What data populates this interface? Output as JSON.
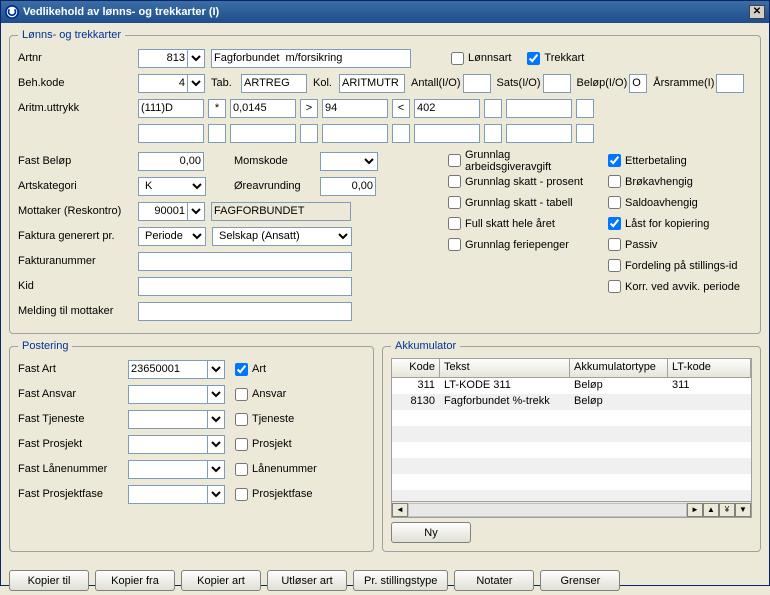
{
  "window": {
    "title": "Vedlikehold av lønns- og trekkarter (I)"
  },
  "group1": {
    "legend": "Lønns- og trekkarter",
    "artnr": {
      "label": "Artnr",
      "value": "813",
      "desc": "Fagforbundet  m/forsikring"
    },
    "lonnsart": "Lønnsart",
    "trekkart": "Trekkart",
    "behkode": {
      "label": "Beh.kode",
      "value": "4"
    },
    "tab": {
      "label": "Tab.",
      "value": "ARTREG"
    },
    "kol": {
      "label": "Kol.",
      "value": "ARITMUTR"
    },
    "antall": {
      "label": "Antall(I/O)"
    },
    "sats": {
      "label": "Sats(I/O)"
    },
    "belop": {
      "label": "Beløp(I/O)",
      "value": "O"
    },
    "arsramme": {
      "label": "Årsramme(I)"
    },
    "aritm": {
      "label": "Aritm.uttrykk",
      "p1": "(111)D",
      "op1": "*",
      "p2": "0,0145",
      "op2": ">",
      "p3": "94",
      "op3": "<",
      "p4": "402"
    },
    "fastbelop": {
      "label": "Fast Beløp",
      "value": "0,00"
    },
    "momskode": {
      "label": "Momskode"
    },
    "artskategori": {
      "label": "Artskategori",
      "value": "K"
    },
    "oreavrunding": {
      "label": "Øreavrunding",
      "value": "0,00"
    },
    "mottaker": {
      "label": "Mottaker (Reskontro)",
      "value": "90001",
      "desc": "FAGFORBUNDET"
    },
    "fakturagen": {
      "label": "Faktura generert pr.",
      "value": "Periode",
      "value2": "Selskap (Ansatt)"
    },
    "fakturanr": {
      "label": "Fakturanummer"
    },
    "kid": {
      "label": "Kid"
    },
    "melding": {
      "label": "Melding til mottaker"
    }
  },
  "checks": {
    "left": [
      "Grunnlag arbeidsgiveravgift",
      "Grunnlag skatt - prosent",
      "Grunnlag skatt - tabell",
      "Full skatt hele året",
      "Grunnlag feriepenger"
    ],
    "right": [
      "Etterbetaling",
      "Brøkavhengig",
      "Saldoavhengig",
      "Låst for kopiering",
      "Passiv",
      "Fordeling på stillings-id",
      "Korr. ved avvik. periode"
    ]
  },
  "postering": {
    "legend": "Postering",
    "fastart": {
      "label": "Fast Art",
      "value": "23650001",
      "chk": "Art"
    },
    "fastansvar": {
      "label": "Fast Ansvar",
      "chk": "Ansvar"
    },
    "fasttjeneste": {
      "label": "Fast Tjeneste",
      "chk": "Tjeneste"
    },
    "fastprosjekt": {
      "label": "Fast Prosjekt",
      "chk": "Prosjekt"
    },
    "fastlaan": {
      "label": "Fast Lånenummer",
      "chk": "Lånenummer"
    },
    "fastfase": {
      "label": "Fast Prosjektfase",
      "chk": "Prosjektfase"
    }
  },
  "akk": {
    "legend": "Akkumulator",
    "cols": [
      "Kode",
      "Tekst",
      "Akkumulatortype",
      "LT-kode"
    ],
    "rows": [
      {
        "kode": "311",
        "tekst": "LT-KODE 311",
        "type": "Beløp",
        "lt": "311"
      },
      {
        "kode": "8130",
        "tekst": "Fagforbundet %-trekk",
        "type": "Beløp",
        "lt": ""
      }
    ],
    "ny": "Ny"
  },
  "buttons": [
    "Kopier til",
    "Kopier fra",
    "Kopier art",
    "Utløser art",
    "Pr. stillingstype",
    "Notater",
    "Grenser"
  ]
}
